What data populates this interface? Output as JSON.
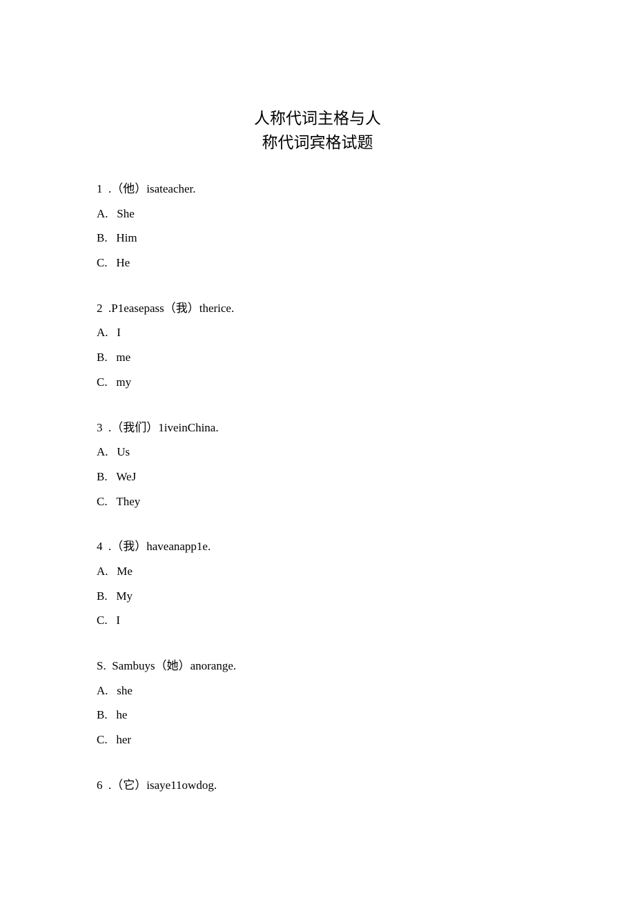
{
  "title_line1": "人称代词主格与人",
  "title_line2": "称代词宾格试题",
  "questions": {
    "q1": {
      "number": "1",
      "hint": "（他）",
      "sentence": "isateacher.",
      "a": "She",
      "b": "Him",
      "c": "He"
    },
    "q2": {
      "number": "2",
      "prefix": "P1easepass",
      "hint": "（我）",
      "suffix": "therice.",
      "a": "I",
      "b": "me",
      "c": "my"
    },
    "q3": {
      "number": "3",
      "hint": "（我们）",
      "sentence": "1iveinChina.",
      "a": "Us",
      "b": "WeJ",
      "c": "They"
    },
    "q4": {
      "number": "4",
      "hint": "（我）",
      "sentence": "haveanapp1e.",
      "a": "Me",
      "b": "My",
      "c": "I"
    },
    "q5": {
      "number": "S.",
      "prefix": "Sambuys",
      "hint": "（她）",
      "suffix": "anorange.",
      "a": "she",
      "b": "he",
      "c": "her"
    },
    "q6": {
      "number": "6",
      "hint": "（它）",
      "sentence": "isaye11owdog."
    }
  },
  "labels": {
    "a": "A.",
    "b": "B.",
    "c": "C.",
    "dot": "."
  }
}
